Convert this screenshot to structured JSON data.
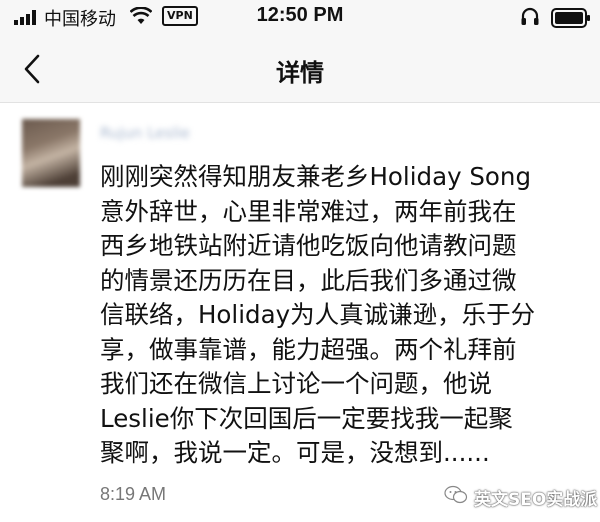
{
  "status_bar": {
    "carrier": "中国移动",
    "vpn_label": "VPN",
    "time": "12:50 PM"
  },
  "nav": {
    "title": "详情"
  },
  "post": {
    "author": "Rujun Leslie",
    "lines": [
      "刚刚突然得知朋友兼老乡Holiday Song",
      "意外辞世，心里非常难过，两年前我在",
      "西乡地铁站附近请他吃饭向他请教问题",
      "的情景还历历在目，此后我们多通过微",
      "信联络，Holiday为人真诚谦逊，乐于分",
      "享，做事靠谱，能力超强。两个礼拜前",
      "我们还在微信上讨论一个问题，他说",
      "Leslie你下次回国后一定要找我一起聚",
      "聚啊，我说一定。可是，没想到......"
    ],
    "time": "8:19 AM"
  },
  "watermark": {
    "text": "英文SEO实战派"
  }
}
